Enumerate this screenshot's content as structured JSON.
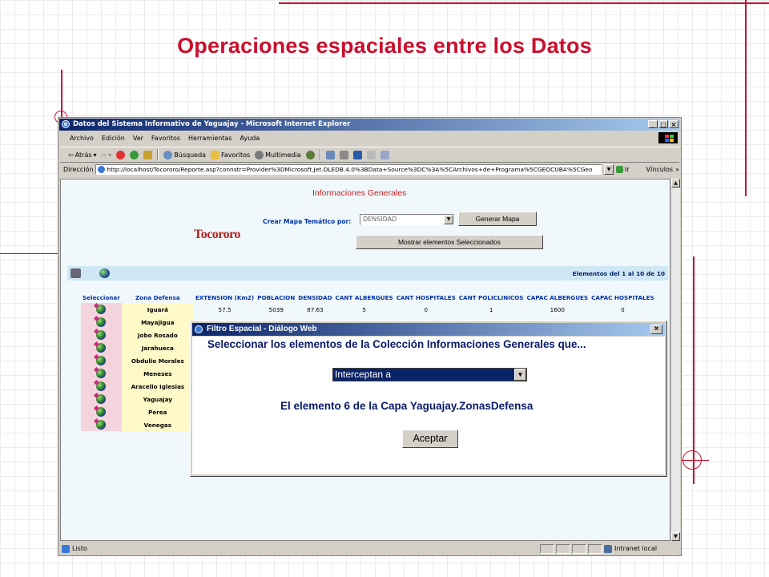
{
  "slide": {
    "title": "Operaciones espaciales entre los Datos",
    "accent_color": "#c8102e"
  },
  "browser": {
    "window_title": "Datos del Sistema Informativo de Yaguajay - Microsoft Internet Explorer",
    "menu": [
      "Archivo",
      "Edición",
      "Ver",
      "Favoritos",
      "Herramientas",
      "Ayuda"
    ],
    "toolbar": {
      "back": "Atrás",
      "search": "Búsqueda",
      "favorites": "Favoritos",
      "multimedia": "Multimedia"
    },
    "address_label": "Dirección",
    "address_value": "http://localhost/Tocororo/Reporte.asp?connstr=Provider%3DMicrosoft.Jet.OLEDB.4.0%3BData+Source%3DC%3A%5CArchivos+de+Programa%5CGEOCUBA%5CGeo",
    "go_label": "Ir",
    "links_label": "Vínculos",
    "status_text": "Listo",
    "zone_text": "Intranet local"
  },
  "page": {
    "heading": "Informaciones Generales",
    "crear_label": "Crear Mapa Temático por:",
    "crear_select_value": "DENSIDAD",
    "generar_button": "Generar Mapa",
    "mostrar_button": "Mostrar elementos Seleccionados",
    "logo_text": "Tocororo",
    "elementos_text": "Elementos del 1 al 10 de 10",
    "table": {
      "headers": [
        "Seleccionar",
        "Zona Defensa",
        "EXTENSION (Km2)",
        "POBLACION",
        "DENSIDAD",
        "CANT ALBERGUES",
        "CANT HOSPITALES",
        "CANT POLICLINICOS",
        "CAPAC ALBERGUES",
        "CAPAC HOSPITALES"
      ],
      "rows": [
        {
          "zona": "Iguará",
          "ext": "57.5",
          "pob": "5039",
          "den": "87.63",
          "alb": "5",
          "hosp": "0",
          "poli": "1",
          "capalb": "1600",
          "caphosp": "0"
        },
        {
          "zona": "Mayajigua"
        },
        {
          "zona": "Jobo Rosado"
        },
        {
          "zona": "Jarahueca"
        },
        {
          "zona": "Obdulio Morales"
        },
        {
          "zona": "Meneses"
        },
        {
          "zona": "Aracelio Iglesias"
        },
        {
          "zona": "Yaguajay"
        },
        {
          "zona": "Perea"
        },
        {
          "zona": "Venegas"
        }
      ]
    }
  },
  "dialog": {
    "title": "Filtro Espacial - Diálogo Web",
    "heading": "Seleccionar los elementos de la Colección Informaciones Generales que...",
    "select_value": "Interceptan a",
    "element_text": "El elemento 6 de la Capa Yaguajay.ZonasDefensa",
    "accept_button": "Aceptar"
  }
}
